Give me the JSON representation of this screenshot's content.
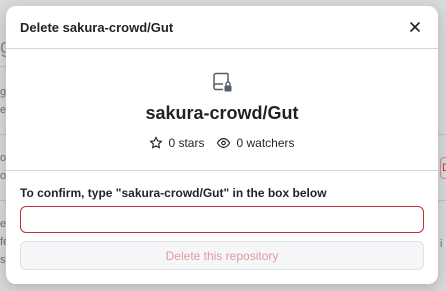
{
  "background": {
    "fragments": [
      "g",
      "g",
      "e",
      "ol",
      "o",
      "ef",
      "fe",
      "si",
      "i"
    ],
    "danger_fragment": "D"
  },
  "dialog": {
    "title": "Delete sakura-crowd/Gut",
    "close_icon": "x-icon",
    "repo_icon": "repo-locked-icon",
    "repo_name": "sakura-crowd/Gut",
    "stars": "0 stars",
    "star_icon": "star-icon",
    "watchers": "0 watchers",
    "watch_icon": "eye-icon",
    "confirm_label": "To confirm, type \"sakura-crowd/Gut\" in the box below",
    "confirm_value": "",
    "delete_label": "Delete this repository",
    "colors": {
      "input_border": "#c0303c",
      "delete_text_disabled": "#e29aa0"
    }
  }
}
